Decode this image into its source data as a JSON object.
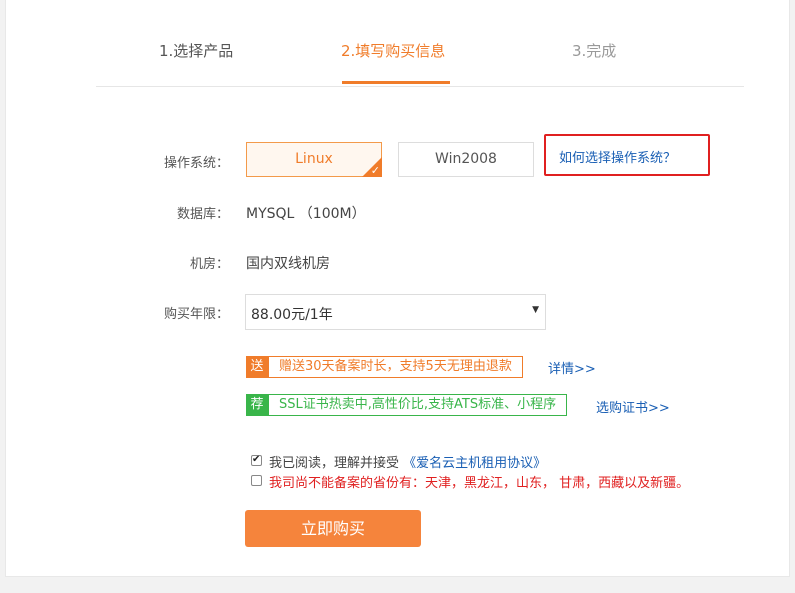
{
  "steps": [
    {
      "label": "1.选择产品"
    },
    {
      "label": "2.填写购买信息"
    },
    {
      "label": "3.完成"
    }
  ],
  "form": {
    "os": {
      "label": "操作系统：",
      "options": [
        "Linux",
        "Win2008"
      ],
      "selected": "Linux",
      "help_link": "如何选择操作系统？"
    },
    "database": {
      "label": "数据库：",
      "value": "MYSQL （100M）"
    },
    "datacenter": {
      "label": "机房：",
      "value": "国内双线机房"
    },
    "term": {
      "label": "购买年限：",
      "selected": "88.00元/1年"
    }
  },
  "promos": [
    {
      "tag": "送",
      "text": "赠送30天备案时长，支持5天无理由退款",
      "link": "详情>>",
      "color": "#f07c2a"
    },
    {
      "tag": "荐",
      "text": "SSL证书热卖中,高性价比,支持ATS标准、小程序",
      "link": "选购证书>>",
      "color": "#39b54a"
    }
  ],
  "agreement": {
    "checked": true,
    "text": "我已阅读，理解并接受",
    "link": "《爱名云主机租用协议》"
  },
  "notice": {
    "checked": false,
    "text": "我司尚不能备案的省份有：天津，黑龙江，山东， 甘肃，西藏以及新疆。"
  },
  "buy_button": "立即购买",
  "colors": {
    "accent": "#f07c2a",
    "link": "#1a5fb4",
    "warning": "#e02020",
    "highlight_box": "#e02020"
  }
}
